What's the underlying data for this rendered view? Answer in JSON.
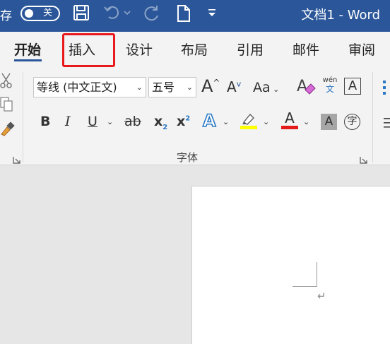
{
  "titlebar": {
    "autosave_label": "存",
    "autosave_state": "关",
    "document_title": "文档1  -  Word",
    "background": "#2b579a",
    "icons": [
      "save-icon",
      "undo-icon",
      "redo-icon",
      "new-document-icon",
      "customize-quick-access-icon"
    ]
  },
  "tabs": [
    {
      "label": "开始",
      "active": true
    },
    {
      "label": "插入",
      "active": false
    },
    {
      "label": "设计",
      "active": false
    },
    {
      "label": "布局",
      "active": false
    },
    {
      "label": "引用",
      "active": false
    },
    {
      "label": "邮件",
      "active": false
    },
    {
      "label": "审阅",
      "active": false
    }
  ],
  "highlight_color": "#e8191c",
  "ribbon": {
    "font_name": "等线 (中文正文)",
    "font_size": "五号",
    "grow_font": "A",
    "shrink_font": "A",
    "change_case": "Aa",
    "phonetic_top": "wén",
    "phonetic_bottom": "文",
    "char_border": "A",
    "bold": "B",
    "italic": "I",
    "underline": "U",
    "strikethrough": "ab",
    "subscript": "x",
    "subscript_sub": "2",
    "superscript": "x",
    "superscript_sup": "2",
    "text_effects": "A",
    "font_color": "A",
    "char_shading": "A",
    "enclose_char": "字",
    "group_label": "字体",
    "font_color_swatch": "#e31b1b",
    "highlight_swatch": "#ffff00"
  },
  "document": {
    "paragraph_mark": "↵"
  }
}
